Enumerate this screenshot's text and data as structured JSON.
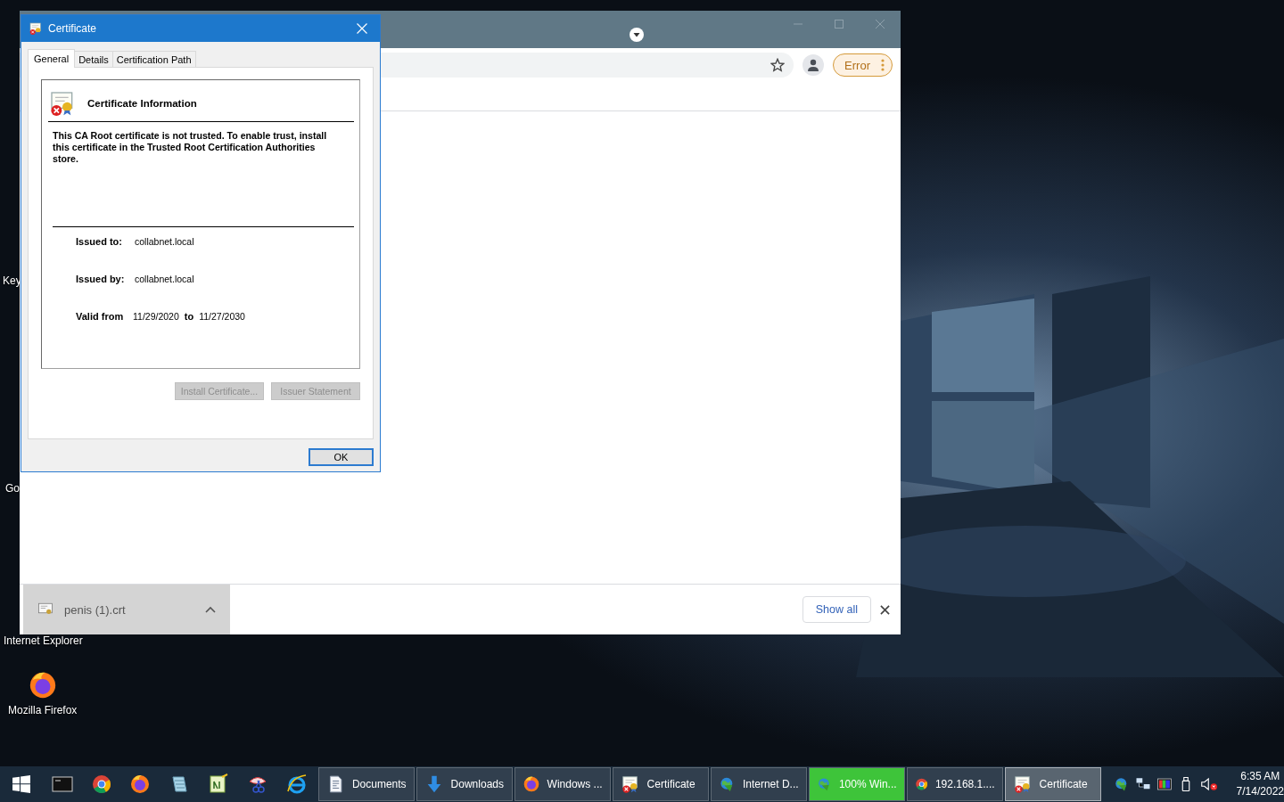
{
  "desktop": {
    "icons": [
      {
        "label": "Key",
        "kind": "label"
      },
      {
        "label": "Go",
        "kind": "label"
      },
      {
        "label": "Internet Explorer",
        "kind": "label"
      },
      {
        "label": "Mozilla Firefox",
        "kind": "firefox"
      }
    ]
  },
  "browser": {
    "status_chip": "Error",
    "download_bar": {
      "items": [
        {
          "file_name": "penis (1).crt"
        }
      ],
      "show_all": "Show all"
    }
  },
  "dialog": {
    "title": "Certificate",
    "tabs": [
      {
        "label": "General",
        "selected": true
      },
      {
        "label": "Details",
        "selected": false
      },
      {
        "label": "Certification Path",
        "selected": false
      }
    ],
    "heading": "Certificate Information",
    "message": "This CA Root certificate is not trusted. To enable trust, install this certificate in the Trusted Root Certification Authorities store.",
    "fields": [
      {
        "label": "Issued to:",
        "value": "collabnet.local"
      },
      {
        "label": "Issued by:",
        "value": "collabnet.local"
      }
    ],
    "validity": {
      "label": "Valid from",
      "from": "11/29/2020",
      "separator": "to",
      "to": "11/27/2030"
    },
    "buttons": [
      {
        "label": "Install Certificate...",
        "disabled": true
      },
      {
        "label": "Issuer Statement",
        "disabled": true
      }
    ],
    "ok": {
      "label": "OK"
    }
  },
  "taskbar": {
    "tasks": [
      {
        "label": "Documents",
        "kind": "document",
        "selected": false
      },
      {
        "label": "Downloads",
        "kind": "download",
        "selected": false
      },
      {
        "label": "Windows ...",
        "kind": "firefox",
        "selected": false
      },
      {
        "label": "Certificate",
        "kind": "certificate",
        "selected": false
      },
      {
        "label": "Internet D...",
        "kind": "globe",
        "selected": false
      },
      {
        "label": "100% Win...",
        "kind": "globe",
        "selected": false,
        "level": 1
      },
      {
        "label": "192.168.1....",
        "kind": "chrome",
        "selected": false
      },
      {
        "label": "Certificate",
        "kind": "certificate",
        "selected": true
      }
    ],
    "clock": {
      "time": "6:35 AM",
      "date": "7/14/2022"
    }
  }
}
